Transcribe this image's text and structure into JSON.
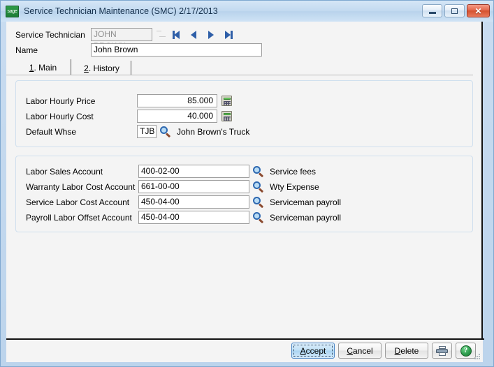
{
  "window": {
    "title": "Service Technician Maintenance (SMC) 2/17/2013",
    "app_icon": "sage-logo-icon",
    "controls": {
      "minimize": "minimize-icon",
      "maximize": "maximize-icon",
      "close": "✕"
    }
  },
  "header": {
    "technician_label": "Service Technician",
    "technician_value": "JOHN BROWN",
    "name_label": "Name",
    "name_value": "John Brown",
    "nav": {
      "first": "first-record-icon",
      "previous": "previous-record-icon",
      "next": "next-record-icon",
      "last": "last-record-icon"
    }
  },
  "tabs": [
    {
      "mnemonic": "1",
      "label": ". Main",
      "active": true
    },
    {
      "mnemonic": "2",
      "label": ". History",
      "active": false
    }
  ],
  "rates_group": {
    "rows": [
      {
        "label": "Labor Hourly Price",
        "value": "85.000",
        "icon": "calculator-icon"
      },
      {
        "label": "Labor Hourly Cost",
        "value": "40.000",
        "icon": "calculator-icon"
      },
      {
        "label": "Default Whse",
        "value": "TJB",
        "icon": "lookup-magnifier-icon",
        "description": "John Brown's Truck"
      }
    ]
  },
  "accounts_group": {
    "rows": [
      {
        "label": "Labor Sales Account",
        "value": "400-02-00",
        "description": "Service fees"
      },
      {
        "label": "Warranty Labor Cost Account",
        "value": "661-00-00",
        "description": "Wty Expense"
      },
      {
        "label": "Service Labor Cost Account",
        "value": "450-04-00",
        "description": "Serviceman payroll"
      },
      {
        "label": "Payroll Labor Offset Account",
        "value": "450-04-00",
        "description": "Serviceman payroll"
      }
    ]
  },
  "buttons": {
    "accept": {
      "mnemonic": "A",
      "rest": "ccept",
      "focused": true
    },
    "cancel": {
      "mnemonic": "C",
      "rest": "ancel"
    },
    "delete": {
      "mnemonic": "D",
      "rest": "elete"
    },
    "print": "printer-icon",
    "help": "?"
  },
  "colors": {
    "titlebar": "#c3daf0",
    "client_bg": "#f4f4f4",
    "accent_blue": "#2f5fa8",
    "close_red": "#d4512f",
    "help_green": "#2f9e4f"
  }
}
